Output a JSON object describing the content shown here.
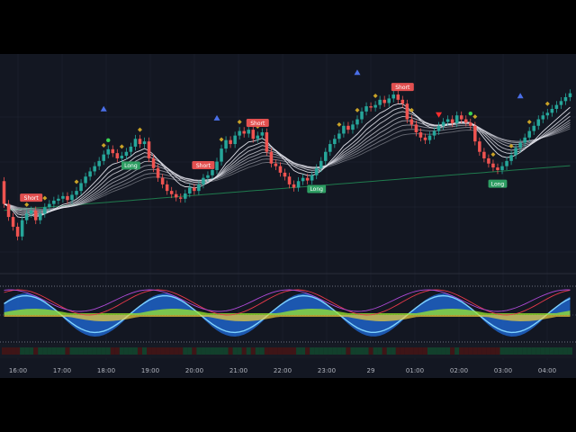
{
  "colors": {
    "background": "#131722",
    "grid": "#1f2433",
    "bull": "#26a69a",
    "bear": "#ef5350",
    "ribbon": "#e8e8f0",
    "wave_blue": "#1e63c8",
    "wave_cyan": "#7fd3ff",
    "money_green": "#9be82e",
    "money_yellow": "#f2d33b",
    "ma_green": "#1f7a4d",
    "long_label": "#2e9e63",
    "short_label": "#e25050",
    "up_arrow": "#4a6fe8",
    "down_arrow": "#ff2d2d"
  },
  "signals": {
    "short": "Short",
    "long": "Long"
  },
  "time_axis": {
    "labels": [
      "16:00",
      "17:00",
      "18:00",
      "19:00",
      "20:00",
      "21:00",
      "22:00",
      "23:00",
      "29",
      "01:00",
      "02:00",
      "03:00",
      "04:00"
    ]
  },
  "price_series": [
    {
      "o": 205,
      "c": 170
    },
    {
      "o": 170,
      "c": 150
    },
    {
      "o": 150,
      "c": 135
    },
    {
      "o": 135,
      "c": 120
    },
    {
      "o": 120,
      "c": 145
    },
    {
      "o": 145,
      "c": 155
    },
    {
      "o": 155,
      "c": 160
    },
    {
      "o": 160,
      "c": 145
    },
    {
      "o": 145,
      "c": 155
    },
    {
      "o": 155,
      "c": 165
    },
    {
      "o": 165,
      "c": 170
    },
    {
      "o": 170,
      "c": 175
    },
    {
      "o": 175,
      "c": 178
    },
    {
      "o": 178,
      "c": 182
    },
    {
      "o": 182,
      "c": 176
    },
    {
      "o": 176,
      "c": 184
    },
    {
      "o": 184,
      "c": 190
    },
    {
      "o": 190,
      "c": 202
    },
    {
      "o": 202,
      "c": 212
    },
    {
      "o": 212,
      "c": 220
    },
    {
      "o": 220,
      "c": 228
    },
    {
      "o": 228,
      "c": 236
    },
    {
      "o": 236,
      "c": 246
    },
    {
      "o": 246,
      "c": 254
    },
    {
      "o": 254,
      "c": 248
    },
    {
      "o": 248,
      "c": 240
    },
    {
      "o": 240,
      "c": 244
    },
    {
      "o": 244,
      "c": 250
    },
    {
      "o": 250,
      "c": 258
    },
    {
      "o": 258,
      "c": 270
    },
    {
      "o": 270,
      "c": 262
    },
    {
      "o": 262,
      "c": 266
    },
    {
      "o": 266,
      "c": 240
    },
    {
      "o": 240,
      "c": 225
    },
    {
      "o": 225,
      "c": 210
    },
    {
      "o": 210,
      "c": 200
    },
    {
      "o": 200,
      "c": 190
    },
    {
      "o": 190,
      "c": 185
    },
    {
      "o": 185,
      "c": 180
    },
    {
      "o": 180,
      "c": 178
    },
    {
      "o": 178,
      "c": 186
    },
    {
      "o": 186,
      "c": 195
    },
    {
      "o": 195,
      "c": 190
    },
    {
      "o": 190,
      "c": 200
    },
    {
      "o": 200,
      "c": 210
    },
    {
      "o": 210,
      "c": 214
    },
    {
      "o": 214,
      "c": 222
    },
    {
      "o": 222,
      "c": 235
    },
    {
      "o": 235,
      "c": 255
    },
    {
      "o": 255,
      "c": 268
    },
    {
      "o": 268,
      "c": 262
    },
    {
      "o": 262,
      "c": 275
    },
    {
      "o": 275,
      "c": 282
    },
    {
      "o": 282,
      "c": 278
    },
    {
      "o": 278,
      "c": 284
    },
    {
      "o": 284,
      "c": 270
    },
    {
      "o": 270,
      "c": 275
    },
    {
      "o": 275,
      "c": 280
    },
    {
      "o": 280,
      "c": 250
    },
    {
      "o": 250,
      "c": 232
    },
    {
      "o": 232,
      "c": 228
    },
    {
      "o": 228,
      "c": 218
    },
    {
      "o": 218,
      "c": 212
    },
    {
      "o": 212,
      "c": 200
    },
    {
      "o": 200,
      "c": 195
    },
    {
      "o": 195,
      "c": 205
    },
    {
      "o": 205,
      "c": 210
    },
    {
      "o": 210,
      "c": 206
    },
    {
      "o": 206,
      "c": 214
    },
    {
      "o": 214,
      "c": 225
    },
    {
      "o": 225,
      "c": 236
    },
    {
      "o": 236,
      "c": 250
    },
    {
      "o": 250,
      "c": 262
    },
    {
      "o": 262,
      "c": 270
    },
    {
      "o": 270,
      "c": 278
    },
    {
      "o": 278,
      "c": 290
    },
    {
      "o": 290,
      "c": 284
    },
    {
      "o": 284,
      "c": 292
    },
    {
      "o": 292,
      "c": 300
    },
    {
      "o": 300,
      "c": 312
    },
    {
      "o": 312,
      "c": 320
    },
    {
      "o": 320,
      "c": 318
    },
    {
      "o": 318,
      "c": 322
    },
    {
      "o": 322,
      "c": 330
    },
    {
      "o": 330,
      "c": 325
    },
    {
      "o": 325,
      "c": 332
    },
    {
      "o": 332,
      "c": 338
    },
    {
      "o": 338,
      "c": 330
    },
    {
      "o": 330,
      "c": 324
    },
    {
      "o": 324,
      "c": 300
    },
    {
      "o": 300,
      "c": 292
    },
    {
      "o": 292,
      "c": 280
    },
    {
      "o": 280,
      "c": 272
    },
    {
      "o": 272,
      "c": 268
    },
    {
      "o": 268,
      "c": 275
    },
    {
      "o": 275,
      "c": 282
    },
    {
      "o": 282,
      "c": 290
    },
    {
      "o": 290,
      "c": 296
    },
    {
      "o": 296,
      "c": 300
    },
    {
      "o": 300,
      "c": 294
    },
    {
      "o": 294,
      "c": 306
    },
    {
      "o": 306,
      "c": 300
    },
    {
      "o": 300,
      "c": 295
    },
    {
      "o": 295,
      "c": 290
    },
    {
      "o": 290,
      "c": 266
    },
    {
      "o": 266,
      "c": 250
    },
    {
      "o": 250,
      "c": 240
    },
    {
      "o": 240,
      "c": 232
    },
    {
      "o": 232,
      "c": 226
    },
    {
      "o": 226,
      "c": 222
    },
    {
      "o": 222,
      "c": 228
    },
    {
      "o": 228,
      "c": 236
    },
    {
      "o": 236,
      "c": 245
    },
    {
      "o": 245,
      "c": 256
    },
    {
      "o": 256,
      "c": 264
    },
    {
      "o": 264,
      "c": 272
    },
    {
      "o": 272,
      "c": 282
    },
    {
      "o": 282,
      "c": 290
    },
    {
      "o": 290,
      "c": 300
    },
    {
      "o": 300,
      "c": 306
    },
    {
      "o": 306,
      "c": 310
    },
    {
      "o": 310,
      "c": 316
    },
    {
      "o": 316,
      "c": 322
    },
    {
      "o": 322,
      "c": 328
    },
    {
      "o": 328,
      "c": 334
    },
    {
      "o": 334,
      "c": 340
    }
  ]
}
